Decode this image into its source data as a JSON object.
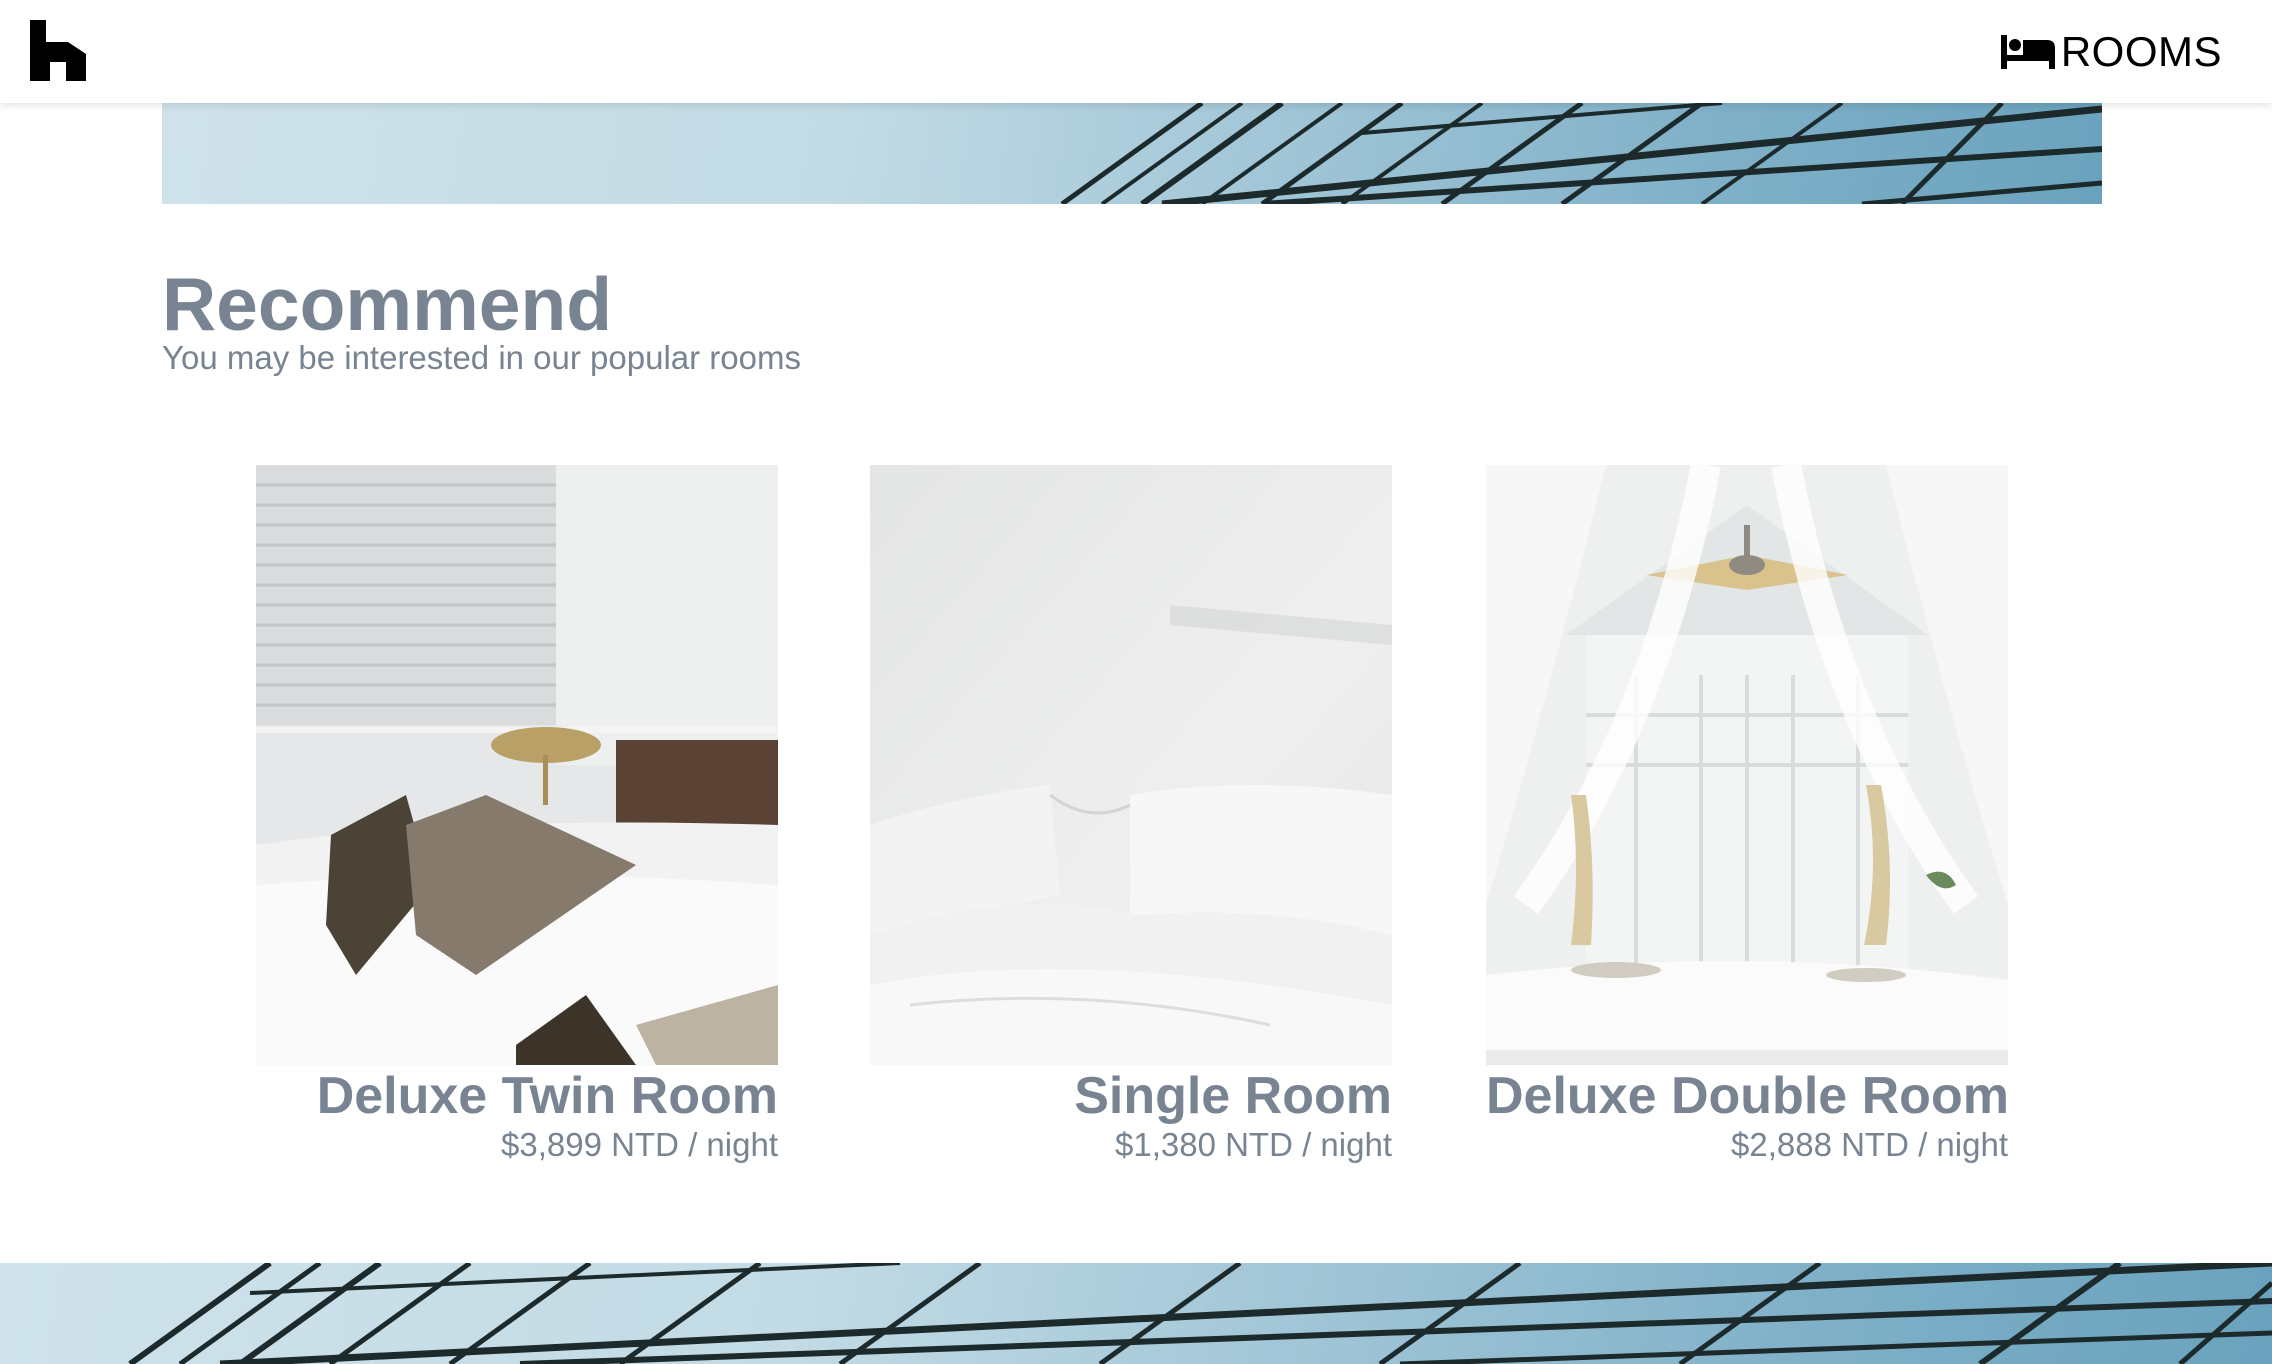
{
  "header": {
    "logo_icon": "house-logo-icon",
    "nav_icon": "bed-icon",
    "nav_label": "ROOMS"
  },
  "section": {
    "title": "Recommend",
    "subtitle": "You may be interested in our popular rooms"
  },
  "rooms": [
    {
      "name": "Deluxe Twin Room",
      "price": "$3,899 NTD / night",
      "photo": "twin-room-photo"
    },
    {
      "name": "Single Room",
      "price": "$1,380 NTD / night",
      "photo": "single-room-photo"
    },
    {
      "name": "Deluxe Double Room",
      "price": "$2,888 NTD / night",
      "photo": "double-room-photo"
    }
  ],
  "colors": {
    "text_muted": "#788491",
    "glass_blue": "#7fb0c8",
    "frame": "#1d2a2c"
  }
}
